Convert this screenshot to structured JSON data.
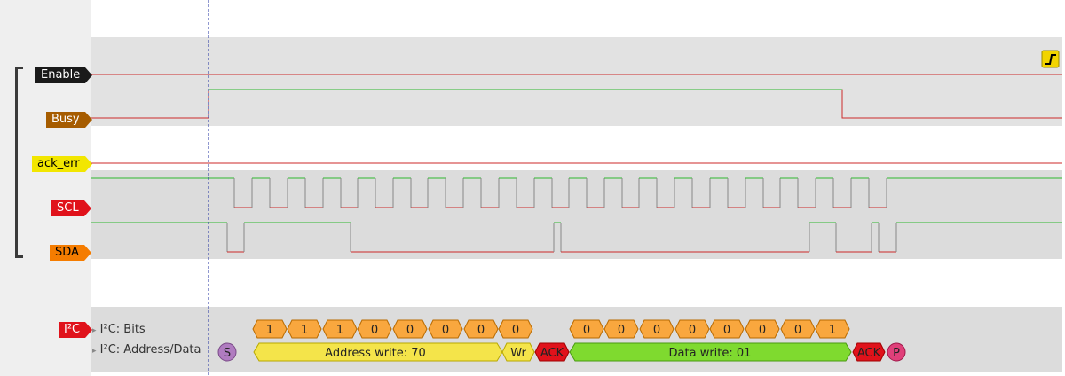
{
  "channels": {
    "enable": {
      "label": "Enable",
      "color": "#1a1a1a",
      "text_color": "#ffffff"
    },
    "busy": {
      "label": "Busy",
      "color": "#a65c00",
      "text_color": "#ffffff"
    },
    "ack_err": {
      "label": "ack_err",
      "color": "#f2e600",
      "text_color": "#000000"
    },
    "scl": {
      "label": "SCL",
      "color": "#e0121b",
      "text_color": "#ffffff"
    },
    "sda": {
      "label": "SDA",
      "color": "#f57c00",
      "text_color": "#000000"
    }
  },
  "decoder": {
    "label": "I²C",
    "color": "#e0121b",
    "row_bits_label": "I²C: Bits",
    "row_addr_label": "I²C: Address/Data",
    "bits_address": [
      "1",
      "1",
      "1",
      "0",
      "0",
      "0",
      "0",
      "0"
    ],
    "bits_data": [
      "0",
      "0",
      "0",
      "0",
      "0",
      "0",
      "0",
      "1"
    ],
    "start_label": "S",
    "address_write_label": "Address write: 70",
    "wr_label": "Wr",
    "ack1_label": "ACK",
    "data_write_label": "Data write: 01",
    "ack2_label": "ACK",
    "stop_label": "P"
  },
  "trigger_icon": "rising-edge-trigger-icon",
  "colors": {
    "signal_high": "#2eb82e",
    "signal_low": "#cc2a2a",
    "track_bg": "#dcdcdc",
    "bit_fill": "#f9a73e",
    "address_fill": "#f4e44a",
    "data_fill": "#7fda2f",
    "ack_fill": "#e0121b",
    "start_fill": "#b07cc0",
    "stop_fill": "#e0407a",
    "cursor": "#2030a0"
  }
}
